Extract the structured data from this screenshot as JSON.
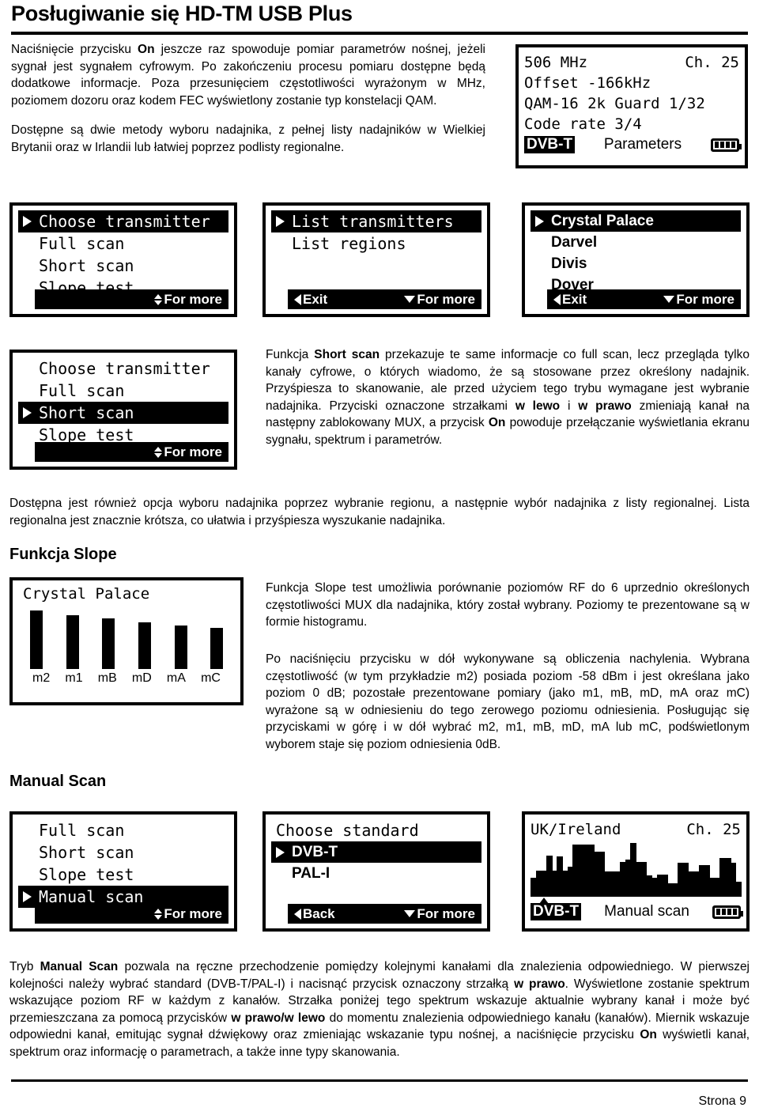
{
  "document": {
    "title": "Posługiwanie się HD-TM USB Plus",
    "footer_page": "Strona 9"
  },
  "intro": {
    "p1_a": "Naciśnięcie przycisku ",
    "p1_b": "On",
    "p1_c": " jeszcze raz spowoduje pomiar parametrów nośnej, jeżeli sygnał jest sygnałem cyfrowym. Po zakończeniu procesu pomiaru dostępne będą dodatkowe informacje. Poza przesunięciem częstotliwości wyrażonym w MHz, poziomem dozoru oraz kodem FEC wyświetlony zostanie typ konstelacji QAM.",
    "p2": "Dostępne są dwie metody wyboru nadajnika, z pełnej listy nadajników w Wielkiej Brytanii oraz w Irlandii lub łatwiej poprzez podlisty regionalne."
  },
  "screen_parameters": {
    "line1_left": "506 MHz",
    "line1_right": "Ch. 25",
    "line2": "Offset -166kHz",
    "line3": "QAM-16 2k Guard 1/32",
    "line4": "Code rate 3/4",
    "tag": "DVB-T",
    "status": "Parameters",
    "battery_segments": 4
  },
  "screen_choose_transmitter": {
    "items": [
      {
        "label": "Choose transmitter",
        "selected": true
      },
      {
        "label": "Full scan",
        "selected": false
      },
      {
        "label": "Short scan",
        "selected": false
      },
      {
        "label": "Slope test",
        "selected": false
      }
    ],
    "footbar_right": "For more"
  },
  "screen_list": {
    "items": [
      {
        "label": "List transmitters",
        "selected": true
      },
      {
        "label": "List regions",
        "selected": false
      }
    ],
    "footbar_left": "Exit",
    "footbar_right": "For more"
  },
  "screen_transmitters": {
    "items": [
      {
        "label": "Crystal Palace",
        "selected": true
      },
      {
        "label": "Darvel",
        "selected": false
      },
      {
        "label": "Divis",
        "selected": false
      },
      {
        "label": "Dover",
        "selected": false
      }
    ],
    "footbar_left": "Exit",
    "footbar_right": "For more"
  },
  "screen_short_scan": {
    "items": [
      {
        "label": "Choose transmitter",
        "selected": false
      },
      {
        "label": "Full scan",
        "selected": false
      },
      {
        "label": "Short scan",
        "selected": true
      },
      {
        "label": "Slope test",
        "selected": false
      }
    ],
    "footbar_right": "For more"
  },
  "short_scan_text": {
    "seg1": "Funkcja ",
    "seg2": "Short scan",
    "seg3": " przekazuje te same informacje co full scan, lecz przegląda tylko kanały cyfrowe, o których wiadomo, że są stosowane przez określony nadajnik. Przyśpiesza to skanowanie, ale przed użyciem tego trybu wymagane jest wybranie nadajnika. Przyciski oznaczone strzałkami ",
    "seg4": "w lewo",
    "seg5": " i ",
    "seg6": "w prawo",
    "seg7": " zmieniają kanał na następny zablokowany MUX, a przycisk ",
    "seg8": "On",
    "seg9": " powoduje przełączanie wyświetlania ekranu sygnału, spektrum i parametrów."
  },
  "region_text": "Dostępna jest również opcja wyboru nadajnika poprzez wybranie regionu, a następnie wybór nadajnika z listy regionalnej. Lista regionalna jest znacznie krótsza, co ułatwia i przyśpiesza wyszukanie nadajnika.",
  "slope": {
    "heading": "Funkcja Slope",
    "p1": "Funkcja Slope test umożliwia porównanie poziomów RF do 6 uprzednio określonych częstotliwości MUX dla nadajnika, który został wybrany. Poziomy te prezentowane są w formie histogramu.",
    "p2": "Po naciśnięciu przycisku w dół wykonywane są obliczenia nachylenia. Wybrana częstotliwość (w tym przykładzie m2) posiada poziom -58 dBm i jest określana jako poziom 0 dB; pozostałe prezentowane pomiary (jako m1, mB, mD, mA oraz mC) wyrażone są w odniesieniu do tego zerowego poziomu odniesienia. Posługując się przyciskami w górę i w dół wybrać m2, m1, mB, mD, mA lub mC, podświetlonym wyborem staje się poziom odniesienia 0dB."
  },
  "chart_data": {
    "type": "bar",
    "title": "Crystal Palace",
    "categories": [
      "m2",
      "m1",
      "mB",
      "mD",
      "mA",
      "mC"
    ],
    "values": [
      100,
      92,
      86,
      80,
      74,
      70
    ],
    "xlabel": "",
    "ylabel": "",
    "ylim": [
      0,
      100
    ],
    "grid": false,
    "note": "Histogram poziomów RF dla 6 częstotliwości MUX; m2 = poziom odniesienia 0 dB (-58 dBm)"
  },
  "manual": {
    "heading": "Manual Scan",
    "screen_menu": {
      "items": [
        {
          "label": "Full scan",
          "selected": false
        },
        {
          "label": "Short scan",
          "selected": false
        },
        {
          "label": "Slope test",
          "selected": false
        },
        {
          "label": "Manual scan",
          "selected": true
        }
      ],
      "footbar_right": "For more"
    },
    "screen_standard": {
      "title": "Choose standard",
      "items": [
        {
          "label": "DVB-T",
          "selected": true
        },
        {
          "label": "PAL-I",
          "selected": false
        }
      ],
      "footbar_left": "Back",
      "footbar_right": "For more"
    },
    "screen_spectrum": {
      "line1_left": "UK/Ireland",
      "line1_right": "Ch. 25",
      "tag": "DVB-T",
      "status": "Manual scan",
      "battery_segments": 4,
      "spectrum_levels": [
        30,
        42,
        42,
        66,
        42,
        64,
        42,
        48,
        84,
        84,
        84,
        84,
        72,
        72,
        40,
        40,
        40,
        56,
        60,
        86,
        56,
        56,
        34,
        30,
        36,
        36,
        22,
        22,
        54,
        54,
        40,
        40,
        50,
        50,
        30,
        30,
        62,
        62,
        54,
        24
      ],
      "marker_index": 2
    },
    "text": {
      "seg1": "Tryb ",
      "seg2": "Manual Scan",
      "seg3": " pozwala na ręczne przechodzenie pomiędzy kolejnymi kanałami dla znalezienia odpowiedniego.  W pierwszej kolejności należy wybrać standard (DVB-T/PAL-I) i nacisnąć przycisk oznaczony strzałką ",
      "seg4": "w prawo",
      "seg5": ". Wyświetlone zostanie spektrum wskazujące poziom RF w każdym z kanałów. Strzałka poniżej tego spektrum wskazuje aktualnie wybrany kanał i może być przemieszczana za pomocą przycisków ",
      "seg6": "w prawo/w lewo",
      "seg7": " do momentu znalezienia odpowiedniego kanału (kanałów). Miernik wskazuje odpowiedni kanał, emitując sygnał dźwiękowy oraz zmieniając wskazanie typu nośnej, a naciśnięcie przycisku ",
      "seg8": "On",
      "seg9": " wyświetli kanał, spektrum oraz informację o parametrach, a także inne typy skanowania."
    }
  }
}
